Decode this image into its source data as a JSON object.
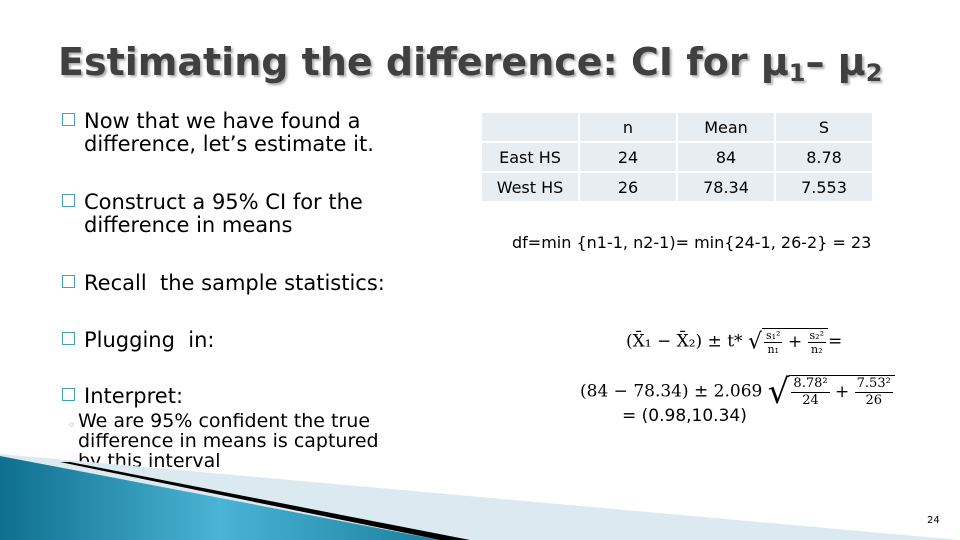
{
  "title": {
    "text": "Estimating the difference: CI for μ",
    "sub1": "1",
    "minus": "– μ",
    "sub2": "2"
  },
  "bullets": [
    {
      "text": "Now that we have found a\ndifference, let’s estimate it."
    },
    {
      "text": "Construct a 95% CI for the\ndifference in means"
    },
    {
      "text": "Recall  the sample statistics:"
    },
    {
      "text": "Plugging  in:"
    },
    {
      "text": "Interpret:"
    }
  ],
  "sub_bullet": {
    "bullet_glyph": "◦",
    "text": "We are 95% confident the true\ndifference in means is captured\nby this interval"
  },
  "stats_table": {
    "headers": [
      "",
      "n",
      "Mean",
      "S"
    ],
    "rows": [
      [
        "East HS",
        "24",
        "84",
        "8.78"
      ],
      [
        "West HS",
        "26",
        "78.34",
        "7.553"
      ]
    ]
  },
  "df_text": "df=min {n1-1, n2-1)=  min{24-1, 26-2} = 23",
  "formula": {
    "line1_left": "(X̄₁ − X̄₂) ± t*",
    "line1_frac1_num": "s₁²",
    "line1_frac1_den": "n₁",
    "line1_plus": "+",
    "line1_frac2_num": "s₂²",
    "line1_frac2_den": "n₂",
    "line1_eq": "=",
    "line2_left": "(84 − 78.34) ± 2.069",
    "line2_frac1_num": "8.78²",
    "line2_frac1_den": "24",
    "line2_plus": "+",
    "line2_frac2_num": "7.53²",
    "line2_frac2_den": "26",
    "line3": "= (0.98,10.34)"
  },
  "page_number": "24",
  "colors": {
    "title": "#404040",
    "bullet_box": "#4aa0b0",
    "table_cell": "#e8edf2",
    "deco_teal": "#1f8fb0"
  }
}
